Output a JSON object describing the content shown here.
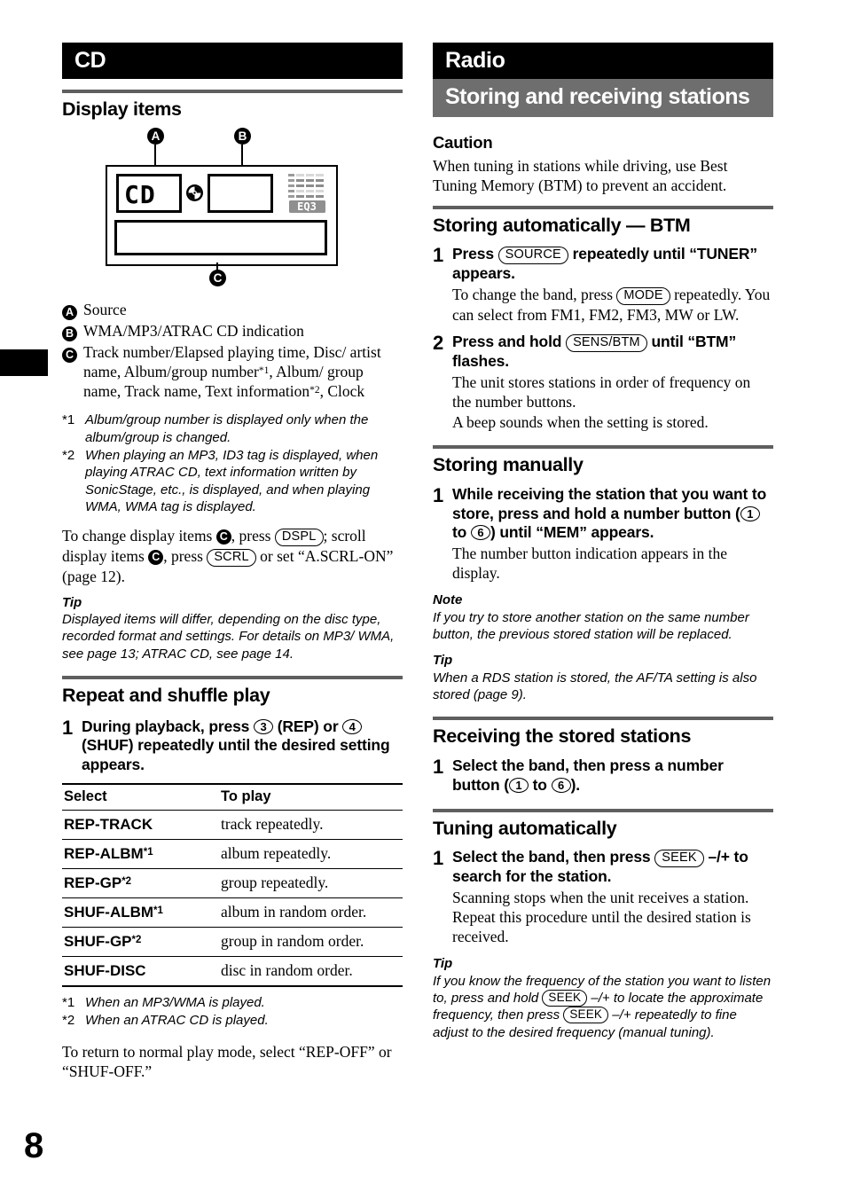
{
  "page": {
    "folio": "8",
    "colors": {
      "banner_black": "#000000",
      "banner_gray": "#6e6e6e",
      "rule_gray": "#5f5f5f"
    }
  },
  "left_column": {
    "chapter_banner": "CD",
    "display_items": {
      "heading": "Display items",
      "diagram": {
        "badge_a": "A",
        "badge_b": "B",
        "badge_c": "C",
        "source_segment_text": "CD",
        "disc_icon": "disc-icon",
        "eq_label": "EQ3"
      },
      "legend": [
        {
          "mark": "A",
          "text": "Source"
        },
        {
          "mark": "B",
          "text": "WMA/MP3/ATRAC CD indication"
        },
        {
          "mark": "C",
          "text": "Track number/Elapsed playing time, Disc/ artist name, Album/group number*1, Album/ group name, Track name, Text information*2, Clock"
        }
      ],
      "footnotes": [
        {
          "mark": "*1",
          "text": "Album/group number is displayed only when the album/group is changed."
        },
        {
          "mark": "*2",
          "text": "When playing an MP3, ID3 tag is displayed, when playing ATRAC CD, text information written by SonicStage, etc., is displayed, and when playing WMA, WMA tag is displayed."
        }
      ],
      "change_paragraph": {
        "part1": "To change display items ",
        "part2": ", press ",
        "button1": "DSPL",
        "part3": "; scroll display items ",
        "part4": ", press ",
        "button2": "SCRL",
        "part5": " or set “A.SCRL-ON” (page 12)."
      },
      "tip_label": "Tip",
      "tip_text": "Displayed items will differ, depending on the disc type, recorded format and settings. For details on MP3/ WMA, see page 13; ATRAC CD, see page 14."
    },
    "repeat_shuffle": {
      "heading": "Repeat and shuffle play",
      "step_number": "1",
      "step_title_part1": "During playback, press ",
      "step_button1": "3",
      "step_title_part2": " (REP) or ",
      "step_button2": "4",
      "step_title_part3": " (SHUF) repeatedly until the desired setting appears.",
      "table": {
        "columns": [
          "Select",
          "To play"
        ],
        "rows": [
          {
            "select": "REP-TRACK",
            "sup": "",
            "play": "track repeatedly."
          },
          {
            "select": "REP-ALBM",
            "sup": "*1",
            "play": "album repeatedly."
          },
          {
            "select": "REP-GP",
            "sup": "*2",
            "play": "group repeatedly."
          },
          {
            "select": "SHUF-ALBM",
            "sup": "*1",
            "play": "album in random order."
          },
          {
            "select": "SHUF-GP",
            "sup": "*2",
            "play": "group in random order."
          },
          {
            "select": "SHUF-DISC",
            "sup": "",
            "play": "disc in random order."
          }
        ]
      },
      "footnotes": [
        {
          "mark": "*1",
          "text": "When an MP3/WMA is played."
        },
        {
          "mark": "*2",
          "text": "When an ATRAC CD is played."
        }
      ],
      "closing": "To return to normal play mode, select “REP-OFF” or “SHUF-OFF.”"
    }
  },
  "right_column": {
    "chapter_banner": "Radio",
    "section_banner": "Storing and receiving stations",
    "caution": {
      "label": "Caution",
      "text": "When tuning in stations while driving, use Best Tuning Memory (BTM) to prevent an accident."
    },
    "storing_auto": {
      "heading": "Storing automatically — BTM",
      "steps": [
        {
          "number": "1",
          "title_part1": "Press ",
          "button": "SOURCE",
          "title_part2": " repeatedly until “TUNER” appears.",
          "desc_part1": "To change the band, press ",
          "desc_button": "MODE",
          "desc_part2": " repeatedly. You can select from FM1, FM2, FM3, MW or LW."
        },
        {
          "number": "2",
          "title_part1": "Press and hold ",
          "button": "SENS/BTM",
          "title_part2": " until “BTM” flashes.",
          "desc_part1": "The unit stores stations in order of frequency on the number buttons.",
          "desc_part2": "A beep sounds when the setting is stored."
        }
      ]
    },
    "storing_manual": {
      "heading": "Storing manually",
      "step_number": "1",
      "title_part1": "While receiving the station that you want to store, press and hold a number button (",
      "button_from": "1",
      "title_part2": " to ",
      "button_to": "6",
      "title_part3": ") until “MEM” appears.",
      "desc": "The number button indication appears in the display.",
      "note_label": "Note",
      "note_text": "If you try to store another station on the same number button, the previous stored station will be replaced.",
      "tip_label": "Tip",
      "tip_text": "When a RDS station is stored, the AF/TA setting is also stored (page 9)."
    },
    "receiving_stored": {
      "heading": "Receiving the stored stations",
      "step_number": "1",
      "title_part1": "Select the band, then press a number button (",
      "button_from": "1",
      "title_part2": " to ",
      "button_to": "6",
      "title_part3": ")."
    },
    "tuning_auto": {
      "heading": "Tuning automatically",
      "step_number": "1",
      "title_part1": "Select the band, then press ",
      "button": "SEEK",
      "title_part2": " –/+ to search for the station.",
      "desc": "Scanning stops when the unit receives a station. Repeat this procedure until the desired station is received.",
      "tip_label": "Tip",
      "tip_part1": "If you know the frequency of the station you want to listen to, press and hold ",
      "tip_button1": "SEEK",
      "tip_part2": " –/+ to locate the approximate frequency, then press ",
      "tip_button2": "SEEK",
      "tip_part3": " –/+ repeatedly to fine adjust to the desired frequency (manual tuning)."
    }
  }
}
